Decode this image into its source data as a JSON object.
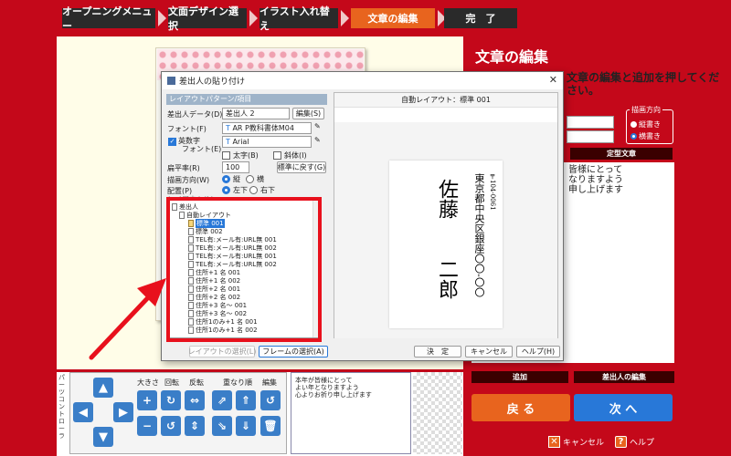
{
  "steps": [
    {
      "label": "オープニングメニュー",
      "active": false
    },
    {
      "label": "文面デザイン選択",
      "active": false
    },
    {
      "label": "イラスト入れ替え",
      "active": false
    },
    {
      "label": "文章の編集",
      "active": true
    },
    {
      "label": "完　了",
      "active": false
    }
  ],
  "right_panel": {
    "title": "文章の編集",
    "description": "文章の編集と追加を押してください。",
    "direction_group": "描画方向",
    "direction_vertical": "縦書き",
    "direction_horizontal": "横書き",
    "template_button": "定型文章",
    "text_lines": [
      "皆様にとって",
      "なりますよう",
      "申し上げます"
    ],
    "add_button": "追加",
    "sender_edit_button": "差出人の編集",
    "back_button": "戻 る",
    "next_button": "次 へ",
    "cancel_label": "キャンセル",
    "help_label": "ヘルプ"
  },
  "parts_controller": {
    "label": "パーツコントローラ",
    "size_label": "大きさ",
    "rotate_label": "回転",
    "flip_label": "反転",
    "order_label": "重なり順",
    "edit_label": "編集",
    "thumb_lines": [
      "本年が皆様にとって",
      "よい年となりますよう",
      "心よりお祈り申し上げます"
    ]
  },
  "dialog": {
    "title": "差出人の貼り付け",
    "close": "✕",
    "section_header": "レイアウトパターン/項目",
    "sender_data_label": "差出人データ(D)",
    "sender_data_value": "差出人 2",
    "edit_button": "編集(S)",
    "font_label": "フォント(F)",
    "font_value": "AR P教科書体M04",
    "alnum_font_label": "英数字",
    "alnum_font_label2": "フォント(E)",
    "alnum_font_value": "Arial",
    "bold_label": "太字(B)",
    "italic_label": "斜体(I)",
    "flatness_label": "扁平率(R)",
    "flatness_value": "100",
    "reset_button": "標準に戻す(G)",
    "direction_label": "描画方向(W)",
    "dir_vertical": "縦",
    "dir_horizontal": "横",
    "placement_label": "配置(P)",
    "place_lower_left": "左下",
    "place_lower_right": "右下",
    "layout_list_label": "レイアウト(L)",
    "tree": [
      {
        "label": "差出人",
        "level": 0,
        "selected": false
      },
      {
        "label": "自動レイアウト",
        "level": 1,
        "selected": false
      },
      {
        "label": "標準 001",
        "level": 2,
        "selected": true
      },
      {
        "label": "標準 002",
        "level": 2,
        "selected": false
      },
      {
        "label": "TEL有:メール有:URL無 001",
        "level": 2,
        "selected": false
      },
      {
        "label": "TEL有:メール有:URL無 002",
        "level": 2,
        "selected": false
      },
      {
        "label": "TEL有:メール有:URL無 001",
        "level": 2,
        "selected": false
      },
      {
        "label": "TEL有:メール有:URL無 002",
        "level": 2,
        "selected": false
      },
      {
        "label": "住所+1 名 001",
        "level": 2,
        "selected": false
      },
      {
        "label": "住所+1 名 002",
        "level": 2,
        "selected": false
      },
      {
        "label": "住所+2 名 001",
        "level": 2,
        "selected": false
      },
      {
        "label": "住所+2 名 002",
        "level": 2,
        "selected": false
      },
      {
        "label": "住所+3 名～ 001",
        "level": 2,
        "selected": false
      },
      {
        "label": "住所+3 名～ 002",
        "level": 2,
        "selected": false
      },
      {
        "label": "住所1のみ+1 名 001",
        "level": 2,
        "selected": false
      },
      {
        "label": "住所1のみ+1 名 002",
        "level": 2,
        "selected": false
      }
    ],
    "preview_header": "自動レイアウト：標準 001",
    "preview_postal": "〒104-0061",
    "preview_address1": "東京都中央区銀座〇〇-〇〇",
    "preview_name1": "佐藤",
    "preview_name2": "二郎",
    "layout_select_button": "レイアウトの選択(L)",
    "frame_select_button": "フレームの選択(A)",
    "ok_button": "決　定",
    "cancel_button": "キャンセル",
    "help_button": "ヘルプ(H)"
  },
  "colors": {
    "accent_red": "#c4081a",
    "active_step": "#e8641e",
    "highlight": "#e8101c",
    "selection_blue": "#2878d8"
  }
}
